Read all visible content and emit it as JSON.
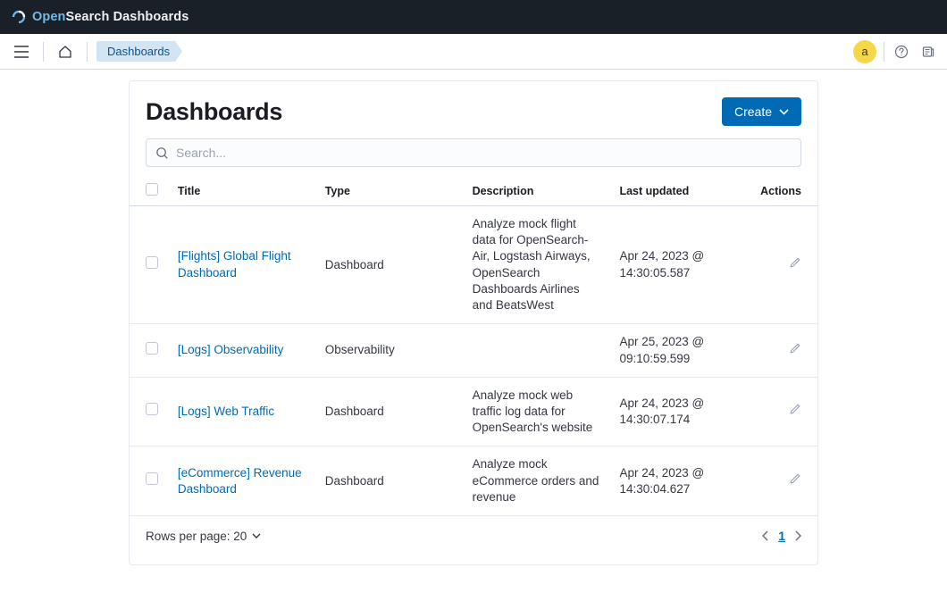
{
  "brand": {
    "open": "Open",
    "search": "Search",
    "dash": " Dashboards"
  },
  "breadcrumb": "Dashboards",
  "avatar_letter": "a",
  "page_title": "Dashboards",
  "create_label": "Create",
  "search": {
    "placeholder": "Search..."
  },
  "columns": {
    "title": "Title",
    "type": "Type",
    "description": "Description",
    "last_updated": "Last updated",
    "actions": "Actions"
  },
  "rows": [
    {
      "title": "[Flights] Global Flight Dashboard",
      "type": "Dashboard",
      "description": "Analyze mock flight data for OpenSearch-Air, Logstash Airways, OpenSearch Dashboards Airlines and BeatsWest",
      "last_updated": "Apr 24, 2023 @ 14:30:05.587"
    },
    {
      "title": "[Logs] Observability",
      "type": "Observability",
      "description": "",
      "last_updated": "Apr 25, 2023 @ 09:10:59.599"
    },
    {
      "title": "[Logs] Web Traffic",
      "type": "Dashboard",
      "description": "Analyze mock web traffic log data for OpenSearch's website",
      "last_updated": "Apr 24, 2023 @ 14:30:07.174"
    },
    {
      "title": "[eCommerce] Revenue Dashboard",
      "type": "Dashboard",
      "description": "Analyze mock eCommerce orders and revenue",
      "last_updated": "Apr 24, 2023 @ 14:30:04.627"
    }
  ],
  "pagination": {
    "rows_label": "Rows per page: 20",
    "current": "1"
  }
}
